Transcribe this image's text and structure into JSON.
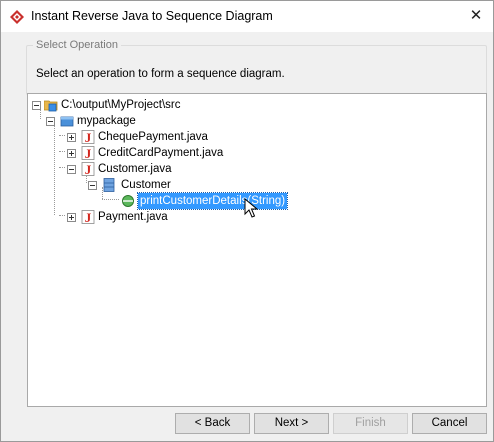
{
  "window": {
    "title": "Instant Reverse Java to Sequence Diagram",
    "close_glyph": "✕",
    "icon": "app-logo-icon",
    "accent_color": "#c9302c"
  },
  "operation_group": {
    "legend": "Select Operation",
    "instruction": "Select an operation to form a sequence diagram."
  },
  "tree": {
    "root": {
      "label": "C:\\output\\MyProject\\src",
      "icon": "source-folder-icon"
    },
    "package": {
      "label": "mypackage",
      "icon": "package-icon"
    },
    "files": [
      {
        "label": "ChequePayment.java",
        "icon": "java-file-icon"
      },
      {
        "label": "CreditCardPayment.java",
        "icon": "java-file-icon"
      },
      {
        "label": "Customer.java",
        "icon": "java-file-icon"
      },
      {
        "label": "Payment.java",
        "icon": "java-file-icon"
      }
    ],
    "class": {
      "label": "Customer",
      "icon": "class-icon"
    },
    "operation": {
      "label": "printCustomerDetails(String)",
      "icon": "operation-icon",
      "selected": true
    },
    "selection_color": "#3399ff"
  },
  "buttons": {
    "back": "< Back",
    "next": "Next >",
    "finish": "Finish",
    "cancel": "Cancel"
  }
}
